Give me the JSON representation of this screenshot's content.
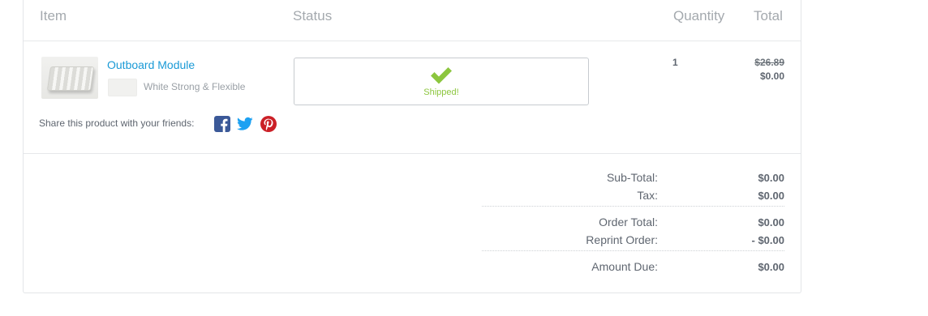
{
  "header": {
    "item": "Item",
    "status": "Status",
    "quantity": "Quantity",
    "total": "Total"
  },
  "product": {
    "name": "Outboard Module",
    "material": "White Strong & Flexible",
    "status": "Shipped!",
    "quantity": "1",
    "original_price": "$26.89",
    "price": "$0.00"
  },
  "share": {
    "label": "Share this product with your friends:",
    "icons": [
      "facebook-icon",
      "twitter-icon",
      "pinterest-icon"
    ]
  },
  "summary": {
    "subtotal_label": "Sub-Total:",
    "subtotal": "$0.00",
    "tax_label": "Tax:",
    "tax": "$0.00",
    "order_total_label": "Order Total:",
    "order_total": "$0.00",
    "reprint_label": "Reprint Order:",
    "reprint": "- $0.00",
    "amount_due_label": "Amount Due:",
    "amount_due": "$0.00"
  },
  "colors": {
    "link": "#1a9ad6",
    "shipped": "#8cc63e",
    "facebook": "#3b5998",
    "twitter": "#1da1f2",
    "pinterest": "#cb2027"
  }
}
